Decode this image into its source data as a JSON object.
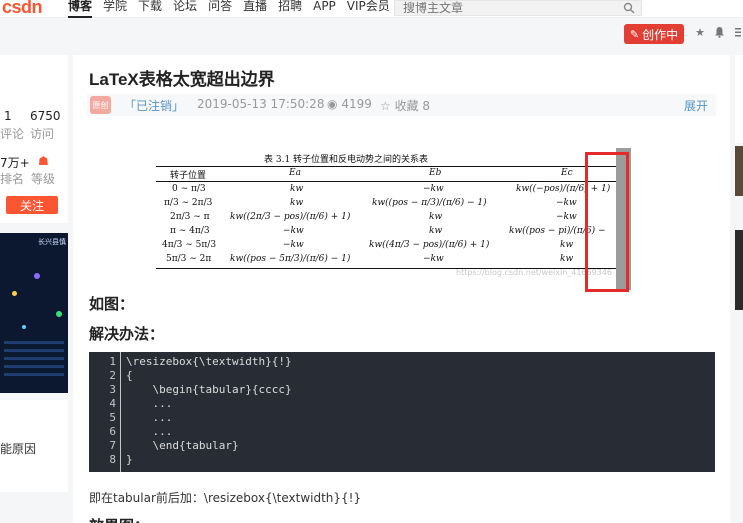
{
  "nav": {
    "logo": "CSDN",
    "items": [
      "博客",
      "学院",
      "下载",
      "论坛",
      "问答",
      "直播",
      "招聘",
      "APP",
      "VIP会员"
    ],
    "search_placeholder": "搜博主文章"
  },
  "toolbar": {
    "create_label": "创作中"
  },
  "sidebar": {
    "stats_top": [
      {
        "value": "1",
        "label": "评论"
      },
      {
        "value": "6750",
        "label": "访问"
      }
    ],
    "stats_bottom": [
      {
        "value": "7万+",
        "label": "排名"
      },
      {
        "label": "等级"
      }
    ],
    "follow_label": "关注",
    "ad_title": "长兴县慎",
    "snippet": "能原因"
  },
  "article": {
    "title": "LaTeX表格太宽超出边界",
    "badge": "原创",
    "author": "「已注销」",
    "date": "2019-05-13 17:50:28",
    "views": "4199",
    "favorites": "收藏 8",
    "expand_label": "展开",
    "heading_figure": "如图：",
    "heading_solution": "解决办法：",
    "after_text": "即在tabular前后加：\\resizebox{\\textwidth}{!}",
    "heading_effect": "效果图："
  },
  "figure": {
    "caption": "表 3.1   转子位置和反电动势之间的关系表",
    "headers": [
      "转子位置",
      "Ea",
      "Eb",
      "Ec"
    ],
    "rows": [
      [
        "0 ∼ π/3",
        "kw",
        "−kw",
        "kw((−pos)/(π/6) + 1)"
      ],
      [
        "π/3 ∼ 2π/3",
        "kw",
        "kw((pos − π/3)/(π/6) − 1)",
        "−kw"
      ],
      [
        "2π/3 ∼ π",
        "kw((2π/3 − pos)/(π/6) + 1)",
        "kw",
        "−kw"
      ],
      [
        "π ∼ 4π/3",
        "−kw",
        "kw",
        "kw((pos − pi)/(π/6) −"
      ],
      [
        "4π/3 ∼ 5π/3",
        "−kw",
        "kw((4π/3 − pos)/(π/6) + 1)",
        "kw"
      ],
      [
        "5π/3 ∼ 2π",
        "kw((pos − 5π/3)/(π/6) − 1)",
        "−kw",
        "kw"
      ]
    ],
    "watermark": "https://blog.csdn.net/weixin_41669346"
  },
  "code": {
    "line_numbers": [
      "1",
      "2",
      "3",
      "4",
      "5",
      "6",
      "7",
      "8"
    ],
    "lines": [
      "\\resizebox{\\textwidth}{!}",
      "{",
      "    \\begin{tabular}{cccc}",
      "    ...",
      "    ...",
      "    ...",
      "    \\end{tabular}",
      "}"
    ]
  },
  "colors": {
    "brand": "#fc5531",
    "create": "#e33e33",
    "code_bg": "#282c34",
    "highlight": "#e52a2a",
    "link": "#5893c2"
  }
}
